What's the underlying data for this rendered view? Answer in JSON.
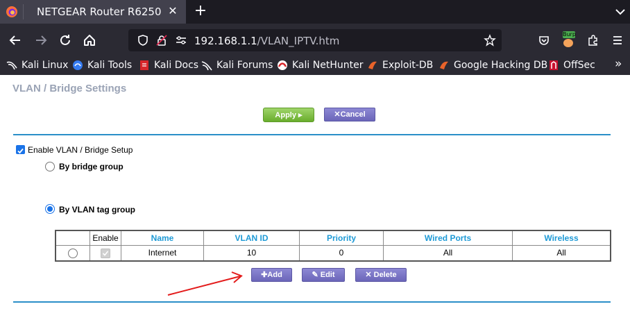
{
  "browser": {
    "tab_title": "NETGEAR Router R6250",
    "url_host": "192.168.1.1",
    "url_path": "/VLAN_IPTV.htm",
    "bookmarks": [
      {
        "label": "Kali Linux",
        "icon": "kali-dragon-icon"
      },
      {
        "label": "Kali Tools",
        "icon": "kali-tools-icon"
      },
      {
        "label": "Kali Docs",
        "icon": "kali-docs-icon"
      },
      {
        "label": "Kali Forums",
        "icon": "kali-forums-icon"
      },
      {
        "label": "Kali NetHunter",
        "icon": "nethunter-icon"
      },
      {
        "label": "Exploit-DB",
        "icon": "exploit-db-icon"
      },
      {
        "label": "Google Hacking DB",
        "icon": "ghdb-icon"
      },
      {
        "label": "OffSec",
        "icon": "offsec-icon"
      }
    ],
    "extension_badge": "Burp"
  },
  "page": {
    "title": "VLAN / Bridge Settings",
    "apply_label": "Apply ▸",
    "cancel_label": "Cancel",
    "enable_label": "Enable VLAN / Bridge Setup",
    "enable_checked": true,
    "bridge_group_label": "By bridge group",
    "vlan_tag_group_label": "By VLAN tag group",
    "selected_mode": "vlan_tag_group",
    "table": {
      "headers": [
        "",
        "Enable",
        "Name",
        "VLAN ID",
        "Priority",
        "Wired Ports",
        "Wireless"
      ],
      "rows": [
        {
          "enable": true,
          "name": "Internet",
          "vlan_id": "10",
          "priority": "0",
          "wired_ports": "All",
          "wireless": "All"
        }
      ]
    },
    "add_label": "Add",
    "edit_label": "Edit",
    "delete_label": "Delete"
  },
  "colors": {
    "accent_blue": "#1e9ad6",
    "rule_blue": "#2a8fc8",
    "apply_green": "#69ad2c",
    "button_purple": "#6b66b9",
    "annotation_red": "#e31b1b"
  }
}
